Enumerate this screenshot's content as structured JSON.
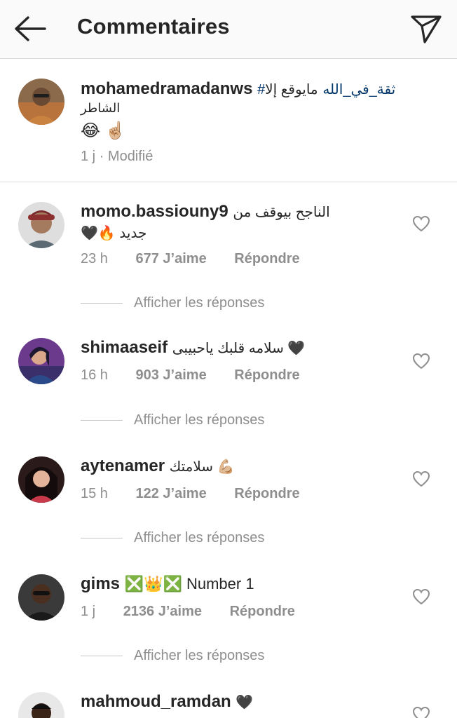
{
  "header": {
    "title": "Commentaires"
  },
  "caption": {
    "username": "mohamedramadanws",
    "hashtag": "#ثقة_في_الله",
    "text_line1": "مايوقع إلا",
    "text_line2": "الشاطر",
    "emojis": "😂 ☝🏼",
    "time": "1 j",
    "edited": "· Modifié"
  },
  "comments": [
    {
      "username": "momo.bassiouny9",
      "text_line1": "الناجح بيوقف من",
      "text_line2": "🖤🔥 جديد",
      "time": "23 h",
      "likes": "677 J’aime",
      "reply": "Répondre",
      "view_replies": "Afficher les réponses"
    },
    {
      "username": "shimaaseif",
      "text_line1": "سلامه قلبك ياحبيبى 🖤",
      "time": "16 h",
      "likes": "903 J’aime",
      "reply": "Répondre",
      "view_replies": "Afficher les réponses"
    },
    {
      "username": "aytenamer",
      "text_line1": "سلامتك 💪🏼",
      "time": "15 h",
      "likes": "122 J’aime",
      "reply": "Répondre",
      "view_replies": "Afficher les réponses"
    },
    {
      "username": "gims",
      "text_line1": "❎👑❎ Number 1",
      "time": "1 j",
      "likes": "2136 J’aime",
      "reply": "Répondre",
      "view_replies": "Afficher les réponses"
    },
    {
      "username": "mahmoud_ramdan",
      "text_line1": "🖤"
    }
  ],
  "icons": {
    "back": "arrow-left-icon",
    "send": "paper-plane-icon",
    "like": "heart-outline-icon"
  },
  "colors": {
    "header_bg": "#fafafa",
    "text": "#262626",
    "muted": "#8e8e8e",
    "hashtag": "#003569",
    "divider": "#dbdbdb"
  }
}
